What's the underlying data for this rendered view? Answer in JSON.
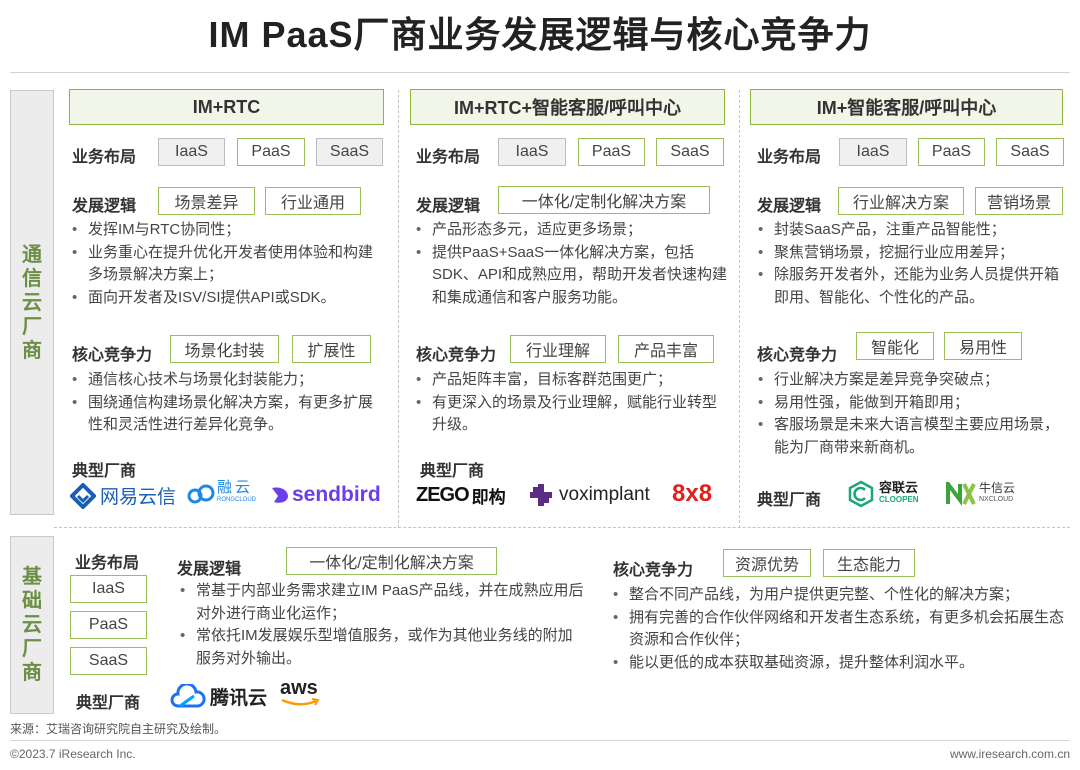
{
  "title": "IM PaaS厂商业务发展逻辑与核心竞争力",
  "side_labels": {
    "telecom": [
      "通",
      "信",
      "云",
      "厂",
      "商"
    ],
    "infra": [
      "基",
      "础",
      "云",
      "厂",
      "商"
    ]
  },
  "common": {
    "layout_label": "业务布局",
    "logic_label": "发展逻辑",
    "core_label": "核心竞争力",
    "vendors_label": "典型厂商",
    "layout_tags": [
      "IaaS",
      "PaaS",
      "SaaS"
    ]
  },
  "columns": [
    {
      "header": "IM+RTC",
      "logic_tags": [
        "场景差异",
        "行业通用"
      ],
      "logic_bullets": [
        "发挥IM与RTC协同性；",
        "业务重心在提升优化开发者使用体验和构建多场景解决方案上；",
        "面向开发者及ISV/SI提供API或SDK。"
      ],
      "core_tags": [
        "场景化封装",
        "扩展性"
      ],
      "core_bullets": [
        "通信核心技术与场景化封装能力；",
        "围绕通信构建场景化解决方案，有更多扩展性和灵活性进行差异化竞争。"
      ],
      "vendors": [
        "网易云信",
        "融云",
        "sendbird"
      ],
      "vendor_sub": {
        "rongcloud": "RONGCLOUD"
      }
    },
    {
      "header": "IM+RTC+智能客服/呼叫中心",
      "logic_tags": [
        "一体化/定制化解决方案"
      ],
      "logic_bullets": [
        "产品形态多元，适应更多场景；",
        "提供PaaS+SaaS一体化解决方案，包括SDK、API和成熟应用，帮助开发者快速构建和集成通信和客户服务功能。"
      ],
      "core_tags": [
        "行业理解",
        "产品丰富"
      ],
      "core_bullets": [
        "产品矩阵丰富，目标客群范围更广；",
        "有更深入的场景及行业理解，赋能行业转型升级。"
      ],
      "vendors": [
        "ZEGO",
        "即构",
        "voximplant",
        "8x8"
      ]
    },
    {
      "header": "IM+智能客服/呼叫中心",
      "logic_tags": [
        "行业解决方案",
        "营销场景"
      ],
      "logic_bullets": [
        "封装SaaS产品，注重产品智能性；",
        "聚焦营销场景，挖掘行业应用差异；",
        "除服务开发者外，还能为业务人员提供开箱即用、智能化、个性化的产品。"
      ],
      "core_tags": [
        "智能化",
        "易用性"
      ],
      "core_bullets": [
        "行业解决方案是差异竞争突破点；",
        "易用性强，能做到开箱即用；",
        "客服场景是未来大语言模型主要应用场景，能为厂商带来新商机。"
      ],
      "vendors": [
        "容联云",
        "CLOOPEN",
        "牛信云",
        "NXCLOUD"
      ]
    }
  ],
  "infra": {
    "logic_tags": [
      "一体化/定制化解决方案"
    ],
    "logic_bullets": [
      "常基于内部业务需求建立IM PaaS产品线，并在成熟应用后对外进行商业化运作；",
      "常依托IM发展娱乐型增值服务，或作为其他业务线的附加服务对外输出。"
    ],
    "core_tags": [
      "资源优势",
      "生态能力"
    ],
    "core_bullets": [
      "整合不同产品线，为用户提供更完整、个性化的解决方案；",
      "拥有完善的合作伙伴网络和开发者生态系统，有更多机会拓展生态资源和合作伙伴；",
      "能以更低的成本获取基础资源，提升整体利润水平。"
    ],
    "vendors": [
      "腾讯云",
      "aws"
    ]
  },
  "footer": {
    "source": "来源：艾瑞咨询研究院自主研究及绘制。",
    "copyright": "©2023.7 iResearch Inc.",
    "url": "www.iresearch.com.cn"
  },
  "colors": {
    "accent_green": "#8db53f",
    "side_text": "#6c8e45",
    "netease_blue": "#1a5fb4",
    "sendbird_purple": "#6c3ee8",
    "rong_blue": "#1e88e5",
    "vox_purple": "#5b2c83",
    "eight_red": "#e0201b",
    "cloopen_green": "#1aa67a",
    "nx_green": "#3ca23c",
    "tencent_blue": "#1d72f3",
    "aws_orange": "#ff9900"
  }
}
